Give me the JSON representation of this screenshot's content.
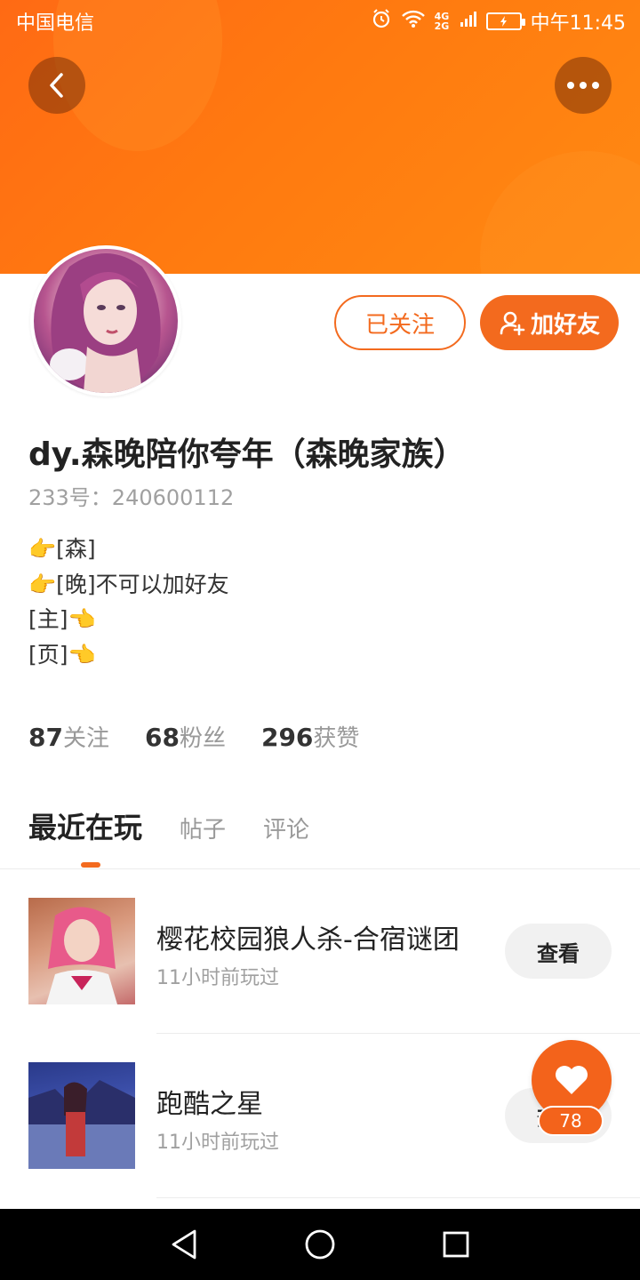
{
  "status_bar": {
    "carrier": "中国电信",
    "network": "4G 2G",
    "time": "中午11:45"
  },
  "icons": {
    "back": "chevron-left-icon",
    "more": "more-dots-icon",
    "alarm": "alarm-icon",
    "wifi": "wifi-icon",
    "signal": "signal-icon",
    "battery": "battery-charging-icon",
    "add_friend": "user-plus-icon",
    "like": "heart-icon",
    "nav_back": "triangle-back-icon",
    "nav_home": "circle-home-icon",
    "nav_recent": "square-recent-icon"
  },
  "colors": {
    "accent": "#f36a1e",
    "header_gradient_start": "#ff6a14",
    "header_gradient_end": "#ff8a12"
  },
  "profile": {
    "follow_label": "已关注",
    "add_friend_label": "加好友",
    "username": "dy.森晚陪你夸年（森晚家族）",
    "id_line": "233号：240600112",
    "bio": [
      "👉[森]",
      "👉[晚]不可以加好友",
      "[主]👈",
      "[页]👈"
    ]
  },
  "stats": [
    {
      "num": "87",
      "label": "关注"
    },
    {
      "num": "68",
      "label": "粉丝"
    },
    {
      "num": "296",
      "label": "获赞"
    }
  ],
  "tabs": [
    {
      "label": "最近在玩"
    },
    {
      "label": "帖子"
    },
    {
      "label": "评论"
    }
  ],
  "games": [
    {
      "title": "樱花校园狼人杀-合宿谜团",
      "subtitle": "11小时前玩过",
      "button": "查看"
    },
    {
      "title": "跑酷之星",
      "subtitle": "11小时前玩过",
      "button": "查看"
    }
  ],
  "like_count": "78"
}
